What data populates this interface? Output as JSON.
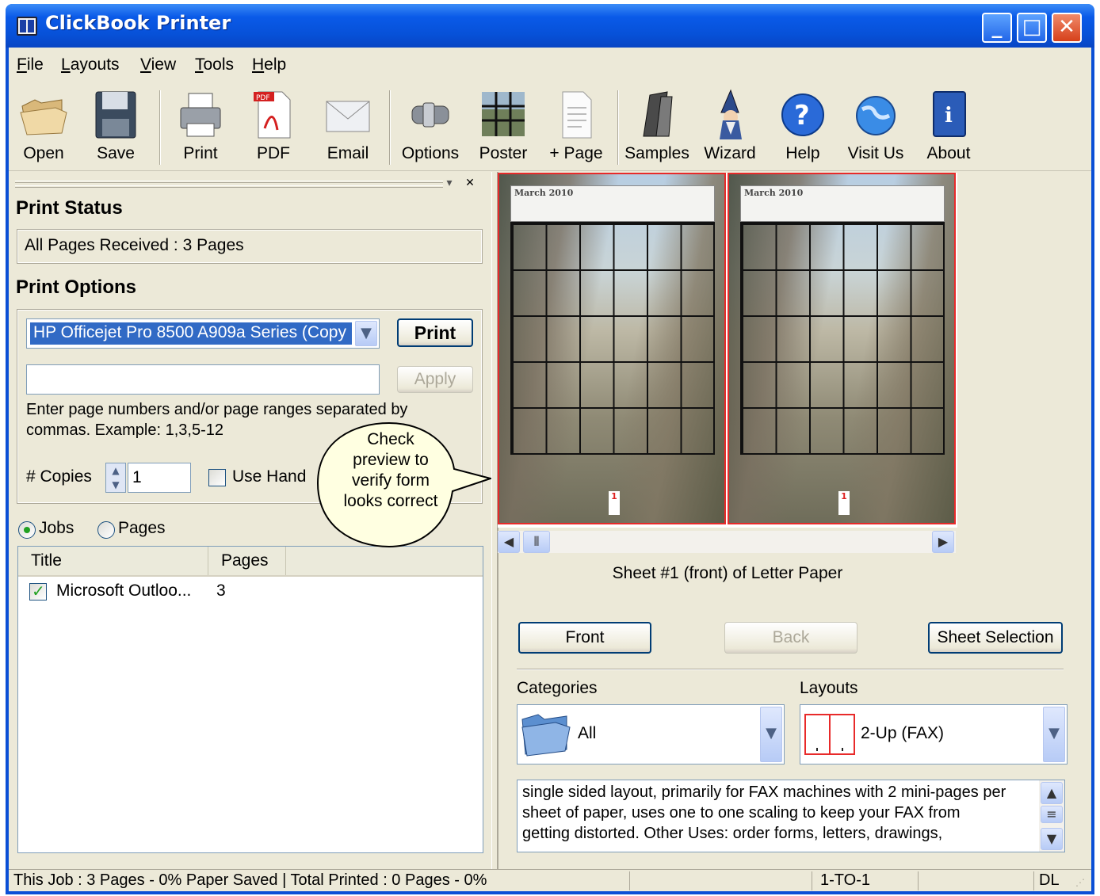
{
  "window": {
    "title": "ClickBook Printer"
  },
  "menu": [
    {
      "label": "File",
      "u": "F",
      "rest": "ile"
    },
    {
      "label": "Layouts",
      "u": "L",
      "rest": "ayouts"
    },
    {
      "label": "View",
      "u": "V",
      "rest": "iew"
    },
    {
      "label": "Tools",
      "u": "T",
      "rest": "ools"
    },
    {
      "label": "Help",
      "u": "H",
      "rest": "elp"
    }
  ],
  "toolbar": {
    "open": "Open",
    "save": "Save",
    "print": "Print",
    "pdf": "PDF",
    "email": "Email",
    "options": "Options",
    "poster": "Poster",
    "add_page": "+ Page",
    "samples": "Samples",
    "wizard": "Wizard",
    "help": "Help",
    "visit_us": "Visit Us",
    "about": "About"
  },
  "print_status": {
    "heading": "Print Status",
    "message": "All Pages Received : 3 Pages"
  },
  "print_options": {
    "heading": "Print Options",
    "printer": "HP Officejet Pro 8500 A909a Series (Copy",
    "print_button": "Print",
    "page_range_value": "",
    "apply_button": "Apply",
    "help_text_line1": "Enter page numbers and/or page ranges separated by",
    "help_text_line2": "commas.  Example:  1,3,5-12",
    "copies_label": "# Copies",
    "copies_value": "1",
    "use_hand_label": "Use Hand"
  },
  "callout": {
    "lines": [
      "Check",
      "preview to",
      "verify form",
      "looks correct"
    ]
  },
  "view_mode": {
    "jobs": "Jobs",
    "pages": "Pages",
    "selected": "jobs"
  },
  "jobs_table": {
    "columns": [
      "Title",
      "Pages"
    ],
    "rows": [
      {
        "checked": true,
        "title": "Microsoft Outloo...",
        "pages": "3"
      }
    ]
  },
  "preview": {
    "month_label": "March 2010",
    "page_number": "1",
    "caption": "Sheet #1 (front) of Letter Paper"
  },
  "sheet_buttons": {
    "front": "Front",
    "back": "Back",
    "sheet_selection": "Sheet Selection"
  },
  "categories": {
    "label": "Categories",
    "value": "All"
  },
  "layouts": {
    "label": "Layouts",
    "value": "2-Up (FAX)"
  },
  "description": {
    "line1": "single sided layout, primarily for FAX machines with 2 mini-pages per",
    "line2": "sheet of paper, uses one to one scaling to keep your FAX from",
    "line3": "getting distorted. Other Uses: order forms, letters, drawings,"
  },
  "status_bar": {
    "job": "This Job : 3 Pages - 0% Paper Saved | Total Printed : 0 Pages - 0%",
    "mode": "1-TO-1",
    "paper": "DL"
  },
  "colors": {
    "title_bar": "#0a5ae8",
    "selection": "#316ac5",
    "sheet_border": "#e82a2a"
  }
}
